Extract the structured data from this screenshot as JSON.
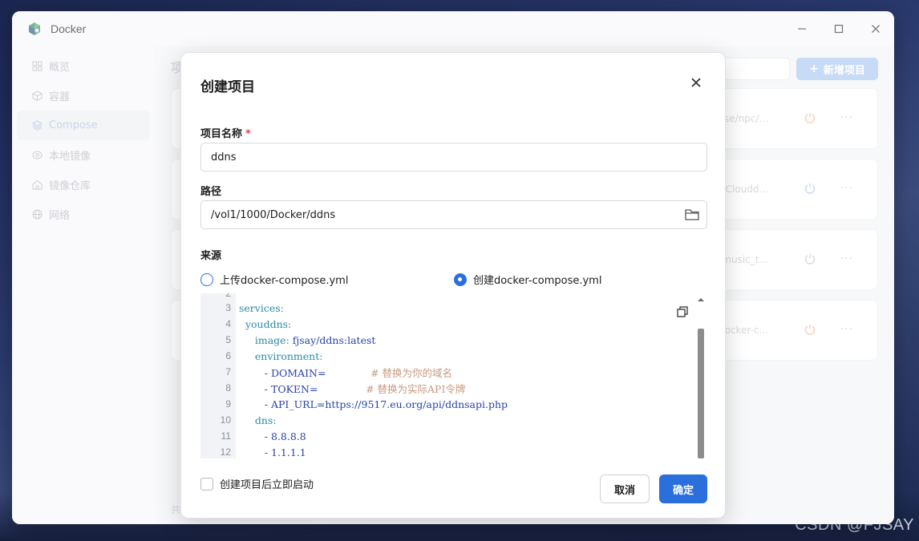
{
  "window": {
    "title": "Docker"
  },
  "sidebar": {
    "items": [
      {
        "label": "概览",
        "icon": "grid-icon",
        "active": false
      },
      {
        "label": "容器",
        "icon": "cube-icon",
        "active": false
      },
      {
        "label": "Compose",
        "icon": "layers-icon",
        "active": true
      },
      {
        "label": "本地镜像",
        "icon": "disc-icon",
        "active": false
      },
      {
        "label": "镜像仓库",
        "icon": "house-icon",
        "active": false
      },
      {
        "label": "网络",
        "icon": "globe-icon",
        "active": false
      }
    ]
  },
  "main": {
    "title": "项",
    "new_button": "新增项目",
    "footer": "共",
    "cards": [
      {
        "path": "se/npc/...",
        "power_color": "#f3b29a"
      },
      {
        "path": "/Cloudd...",
        "power_color": "#a9c0ea"
      },
      {
        "path": "/music_t...",
        "power_color": "#c4c6cb"
      },
      {
        "path": "ocker-c...",
        "power_color": "#f3b29a"
      }
    ]
  },
  "dialog": {
    "title": "创建项目",
    "name_label": "项目名称",
    "name_required": "*",
    "name_value": "ddns",
    "path_label": "路径",
    "path_value": "/vol1/1000/Docker/ddns",
    "source_label": "来源",
    "source_options": [
      {
        "label": "上传docker-compose.yml",
        "checked": false
      },
      {
        "label": "创建docker-compose.yml",
        "checked": true
      }
    ],
    "code_lines": [
      {
        "num": "2",
        "text": ""
      },
      {
        "num": "3",
        "key": "services:",
        "indent": ""
      },
      {
        "num": "4",
        "key": "youddns:",
        "indent": "  "
      },
      {
        "num": "5",
        "key": "image:",
        "val": " fjsay/ddns:latest",
        "indent": "     "
      },
      {
        "num": "6",
        "key": "environment:",
        "indent": "     "
      },
      {
        "num": "7",
        "val": "- DOMAIN=",
        "pad": "              ",
        "comment": "# 替换为你的域名",
        "indent": "        "
      },
      {
        "num": "8",
        "val": "- TOKEN=",
        "pad": "               ",
        "comment": "# 替换为实际API令牌",
        "indent": "        "
      },
      {
        "num": "9",
        "val": "- API_URL=https://9517.eu.org/api/ddnsapi.php",
        "indent": "        "
      },
      {
        "num": "10",
        "key": "dns:",
        "indent": "     "
      },
      {
        "num": "11",
        "val": "- 8.8.8.8",
        "indent": "        "
      },
      {
        "num": "12",
        "val": "- 1.1.1.1",
        "indent": "        "
      }
    ],
    "autostart_label": "创建项目后立即启动",
    "cancel_label": "取消",
    "ok_label": "确定"
  },
  "watermark": "CSDN @FJSAY",
  "colors": {
    "accent": "#2a6fdb",
    "required": "#e0454a",
    "comment": "#c89a82"
  }
}
